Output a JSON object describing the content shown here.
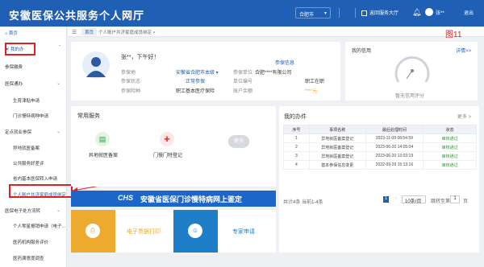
{
  "header": {
    "title": "安徽医保公共服务个人网厅",
    "city": "合肥市",
    "hall": "返回服务大厅",
    "user": "张**",
    "logout": "退出"
  },
  "sidebar": {
    "items": [
      {
        "label": "首页"
      },
      {
        "label": "我的办"
      },
      {
        "label": "参保缴费"
      },
      {
        "label": "医保通办"
      },
      {
        "label": "生育津贴申请"
      },
      {
        "label": "门诊慢特病种申请"
      },
      {
        "label": "定点就业参保"
      },
      {
        "label": "异地就医备案"
      },
      {
        "label": "公共服务好差评"
      },
      {
        "label": "省内基本医保转入申请"
      },
      {
        "label": "个人账户共济家庭成员绑定"
      },
      {
        "label": "医保电子处方流转"
      },
      {
        "label": "个人零星报销申请（电子..."
      },
      {
        "label": "医药机构服务评价"
      },
      {
        "label": "医药满意度调查"
      }
    ]
  },
  "breadcrumb": {
    "home": "首页",
    "current": "个人账户共济家庭成员绑定"
  },
  "annotation": "图11",
  "profile": {
    "greeting": "张**，下午好！",
    "labels": [
      "参保地",
      "参保状态",
      "参保险种",
      "参保单位",
      "单位编号",
      "账户余额"
    ],
    "values": [
      "安徽省合肥市本级",
      "正常参保",
      "职工基本医疗保险",
      "合肥****有限公司",
      "职工在职",
      "****元"
    ],
    "link": "参保信息"
  },
  "credit": {
    "title": "我的信用",
    "detail": "详情>>",
    "caption": "暂无信用评分"
  },
  "services": {
    "title": "常用服务",
    "items": [
      {
        "label": "异地就医备案"
      },
      {
        "label": "门慢门特登记"
      }
    ],
    "more": "更多"
  },
  "tasks": {
    "title": "我的办件",
    "more": "更多 >",
    "headers": [
      "序号",
      "事项名称",
      "最后处理时间",
      "状态"
    ],
    "rows": [
      [
        "1",
        "异地就医备案登记",
        "2023-11-09 08:54:59",
        "审核通过"
      ],
      [
        "2",
        "异地就医备案登记",
        "2023-06-20 14:05:04",
        "审核通过"
      ],
      [
        "3",
        "异地就医备案登记",
        "2023-06-20 13:03:19",
        "审核通过"
      ],
      [
        "4",
        "基本参保信息变更",
        "2022-09-29 15:13:16",
        "审核通过"
      ]
    ],
    "footer": "共计4条 当前1-4条",
    "page": "1",
    "pagesize": "10条/页",
    "jump": "跳转至第",
    "jumpval": "1",
    "unit": "页"
  },
  "banner": {
    "text": "安徽省医保门诊慢特病网上鉴定",
    "logo": "CHS"
  },
  "tiles": [
    {
      "label": "电子票据打印"
    },
    {
      "label": "专家申请"
    }
  ],
  "colors": {
    "primary": "#1f5fb4",
    "highlight": "#e02020",
    "success": "#2e9a3a",
    "tile1": "#ecaa2e",
    "tile2": "#1e7ec8"
  }
}
